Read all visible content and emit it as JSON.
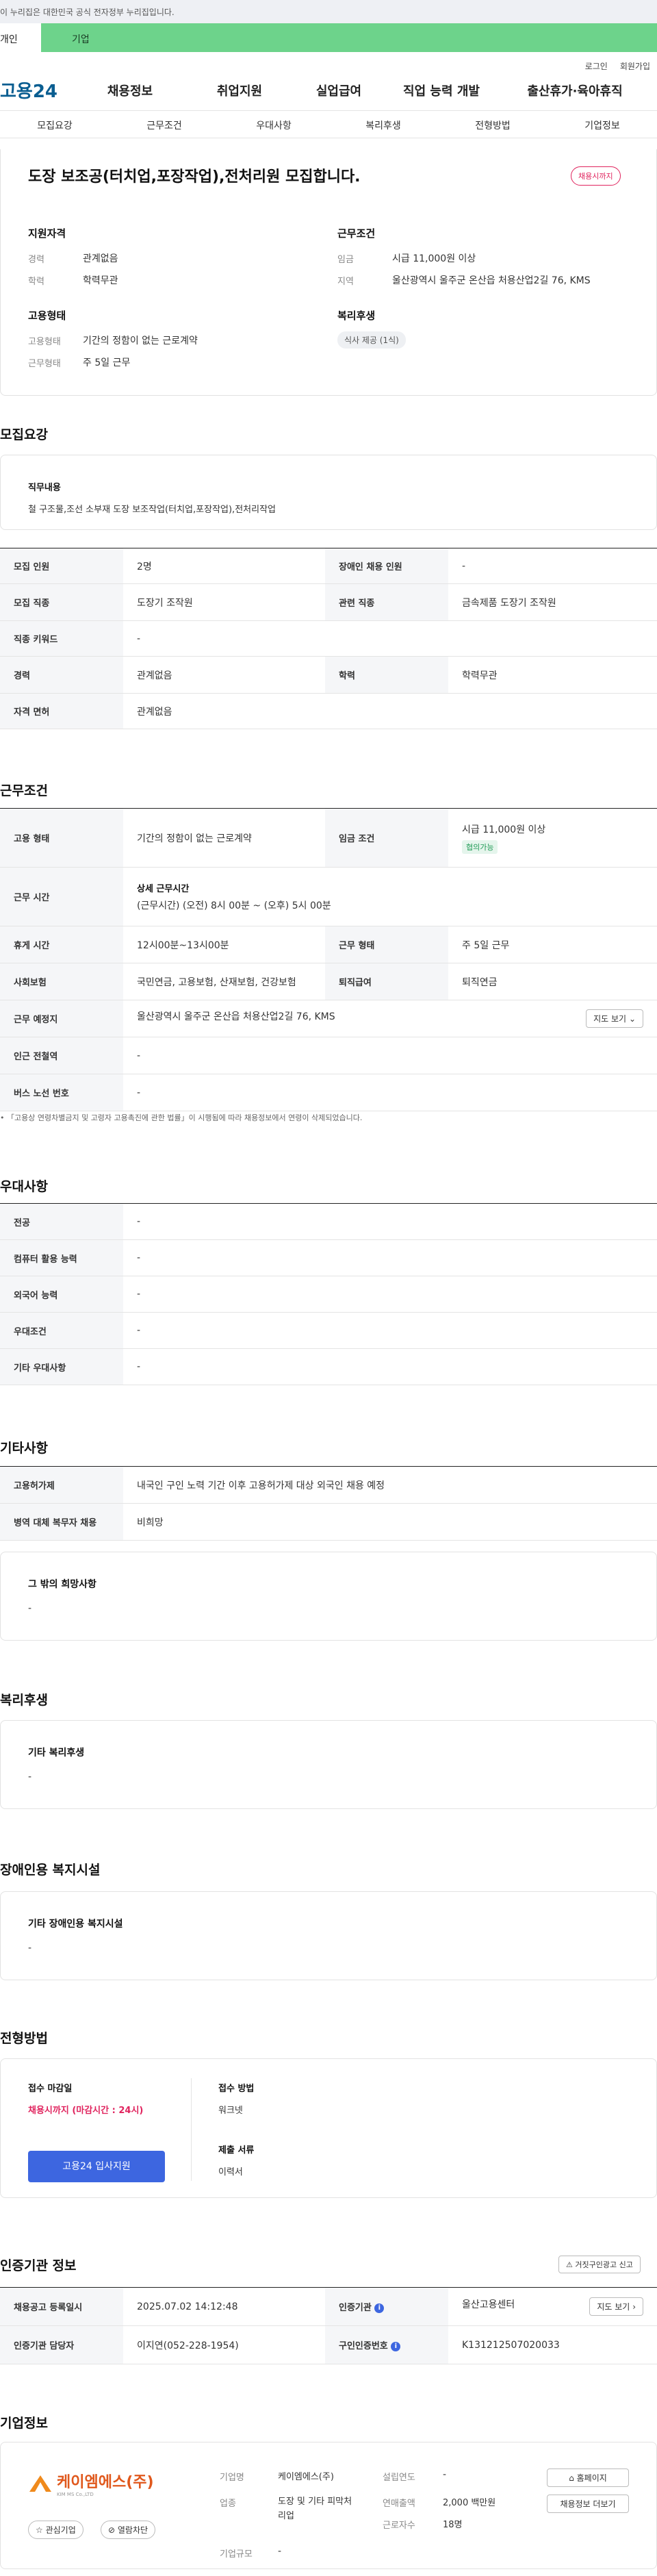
{
  "gov_banner": "이 누리집은 대한민국 공식 전자정부 누리집입니다.",
  "top_tabs": [
    "개인",
    "기업"
  ],
  "util": {
    "login": "로그인",
    "join": "회원가입"
  },
  "logo": "고용24",
  "gnb": [
    "채용정보",
    "취업지원",
    "실업급여",
    "직업 능력 개발",
    "출산휴가·육아휴직"
  ],
  "subnav": [
    "모집요강",
    "근무조건",
    "우대사항",
    "복리후생",
    "전형방법",
    "기업정보"
  ],
  "summary": {
    "title": "도장 보조공(터치업,포장작업),전처리원 모집합니다.",
    "status_badge": "채용시까지",
    "qual_head": "지원자격",
    "cond_head": "근무조건",
    "career_l": "경력",
    "career_v": "관계없음",
    "edu_l": "학력",
    "edu_v": "학력무관",
    "wage_l": "임금",
    "wage_v": "시급 11,000원 이상",
    "area_l": "지역",
    "area_v": "울산광역시 울주군 온산읍 처용산업2길 76, KMS",
    "emp_head": "고용형태",
    "wel_head": "복리후생",
    "emptype_l": "고용형태",
    "emptype_v": "기간의 정함이 없는 근로계약",
    "worktype_l": "근무형태",
    "worktype_v": "주 5일 근무",
    "wel_chip": "식사 제공 (1식)"
  },
  "recruit": {
    "title": "모집요강",
    "job_desc_head": "직무내용",
    "job_desc": "철 구조물,조선 소부재 도장 보조작업(터치업,포장작업),전처리작업",
    "rows": [
      {
        "h1": "모집 인원",
        "v1": "2명",
        "h2": "장애인 채용 인원",
        "v2": "-"
      },
      {
        "h1": "모집 직종",
        "v1": "도장기 조작원",
        "h2": "관련 직종",
        "v2": "금속제품 도장기 조작원"
      },
      {
        "h1": "직종 키워드",
        "v1": "-"
      },
      {
        "h1": "경력",
        "v1": "관계없음",
        "h2": "학력",
        "v2": "학력무관"
      },
      {
        "h1": "자격 면허",
        "v1": "관계없음"
      }
    ]
  },
  "work": {
    "title": "근무조건",
    "emp_h": "고용 형태",
    "emp_v": "기간의 정함이 없는 근로계약",
    "wage_h": "임금 조건",
    "wage_v": "시급 11,000원 이상",
    "wage_badge": "협의가능",
    "time_h": "근무 시간",
    "time_sub": "상세 근무시간",
    "time_v": "(근무시간) (오전) 8시 00분 ~ (오후) 5시 00분",
    "break_h": "휴게 시간",
    "break_v": "12시00분~13시00분",
    "form_h": "근무 형태",
    "form_v": "주 5일 근무",
    "ins_h": "사회보험",
    "ins_v": "국민연금, 고용보험, 산재보험, 건강보험",
    "ret_h": "퇴직급여",
    "ret_v": "퇴직연금",
    "place_h": "근무 예정지",
    "place_v": "울산광역시 울주군 온산읍 처용산업2길 76, KMS",
    "map_btn": "지도 보기",
    "subway_h": "인근 전철역",
    "subway_v": "-",
    "bus_h": "버스 노선 번호",
    "bus_v": "-",
    "note": "「고용상 연령차별금지 및 고령자 고용촉진에 관한 법률」이 시행됨에 따라 채용정보에서 연령이 삭제되었습니다."
  },
  "pref": {
    "title": "우대사항",
    "rows": [
      {
        "h": "전공",
        "v": "-"
      },
      {
        "h": "컴퓨터 활용 능력",
        "v": "-"
      },
      {
        "h": "외국어 능력",
        "v": "-"
      },
      {
        "h": "우대조건",
        "v": "-"
      },
      {
        "h": "기타 우대사항",
        "v": "-"
      }
    ]
  },
  "etc": {
    "title": "기타사항",
    "rows": [
      {
        "h": "고용허가제",
        "v": "내국인 구인 노력 기간 이후 고용허가제 대상 외국인 채용 예정"
      },
      {
        "h": "병역 대체 복무자 채용",
        "v": "비희망"
      }
    ],
    "hope_head": "그 밖의 희망사항",
    "hope_v": "-"
  },
  "welfare": {
    "title": "복리후생",
    "head": "기타 복리후생",
    "v": "-"
  },
  "disabled": {
    "title": "장애인용 복지시설",
    "head": "기타 장애인용 복지시설",
    "v": "-"
  },
  "screening": {
    "title": "전형방법",
    "deadline_head": "접수 마감일",
    "deadline_v": "채용시까지 (마감시간 : 24시)",
    "apply_btn": "고용24 입사지원",
    "method_head": "접수 방법",
    "method_v": "워크넷",
    "docs_head": "제출 서류",
    "docs_v": "이력서"
  },
  "cert": {
    "title": "인증기관 정보",
    "report_btn": "거짓구인광고 신고",
    "reg_h": "채용공고 등록일시",
    "reg_v": "2025.07.02 14:12:48",
    "org_h": "인증기관",
    "org_v": "울산고용센터",
    "map_btn": "지도 보기",
    "mgr_h": "인증기관 담당자",
    "mgr_v": "이지연(052-228-1954)",
    "num_h": "구인인증번호",
    "num_v": "K131212507020033"
  },
  "company": {
    "title": "기업정보",
    "logo_text": "케이엠에스(주)",
    "logo_sub": "KIM MS Co.,LTD",
    "fav_btn": "관심기업",
    "block_btn": "열람차단",
    "name_l": "기업명",
    "name_v": "케이엠에스(주)",
    "ind_l": "업종",
    "ind_v": "도장 및 기타 피막처리업",
    "size_l": "기업규모",
    "size_v": "-",
    "year_l": "설립연도",
    "year_v": "-",
    "sales_l": "연매출액",
    "sales_v": "2,000 백만원",
    "emp_l": "근로자수",
    "emp_v": "18명",
    "home_btn": "홈페이지",
    "more_btn": "채용정보 더보기"
  },
  "colors": {
    "green": "#6dd38b",
    "blue": "#3d66e0",
    "red": "#e0245e"
  }
}
